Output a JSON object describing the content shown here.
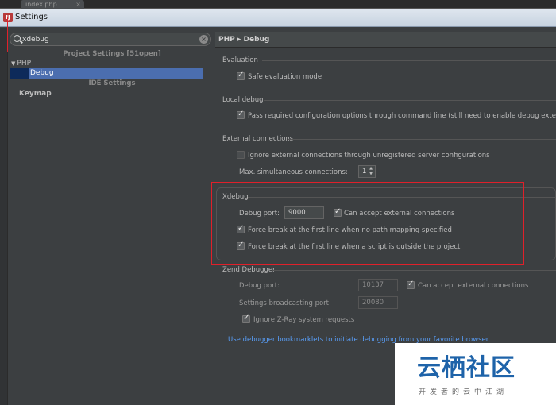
{
  "editor_tab": {
    "label": "index.php",
    "close": "×"
  },
  "window": {
    "icon": "intellij-icon",
    "title": "Settings"
  },
  "search": {
    "value": "xdebug",
    "placeholder": ""
  },
  "left": {
    "project_settings_header": "Project Settings [51open]",
    "tree_php": "PHP",
    "tree_debug": "Debug",
    "ide_settings_header": "IDE Settings",
    "keymap": "Keymap"
  },
  "breadcrumb": "PHP ▸ Debug",
  "evaluation": {
    "group": "Evaluation",
    "safe_eval_label": "Safe evaluation mode",
    "safe_eval_checked": true
  },
  "local_debug": {
    "group": "Local debug",
    "pass_required_label": "Pass required configuration options through command line (still need to enable debug extens",
    "pass_required_checked": true
  },
  "external": {
    "group": "External connections",
    "ignore_label": "Ignore external connections through unregistered server configurations",
    "ignore_checked": false,
    "max_label": "Max. simultaneous connections:",
    "max_value": "1"
  },
  "xdebug": {
    "group": "Xdebug",
    "port_label": "Debug port:",
    "port_value": "9000",
    "can_accept_label": "Can accept external connections",
    "can_accept_checked": true,
    "force_break_no_mapping_label": "Force break at the first line when no path mapping specified",
    "force_break_no_mapping_checked": true,
    "force_break_outside_label": "Force break at the first line when a script is outside the project",
    "force_break_outside_checked": true
  },
  "zend": {
    "group": "Zend Debugger",
    "port_label": "Debug port:",
    "port_value": "10137",
    "can_accept_label": "Can accept external connections",
    "can_accept_checked": true,
    "broadcast_label": "Settings broadcasting port:",
    "broadcast_value": "20080",
    "ignore_zray_label": "Ignore Z-Ray system requests",
    "ignore_zray_checked": true
  },
  "bookmarklets_link": "Use debugger bookmarklets to initiate debugging from your favorite browser",
  "watermark": {
    "title": "云栖社区",
    "subtitle": "开发者的云中江湖"
  },
  "colors": {
    "accent": "#4b6eaf",
    "link": "#589df6",
    "highlight": "#e0202a"
  }
}
